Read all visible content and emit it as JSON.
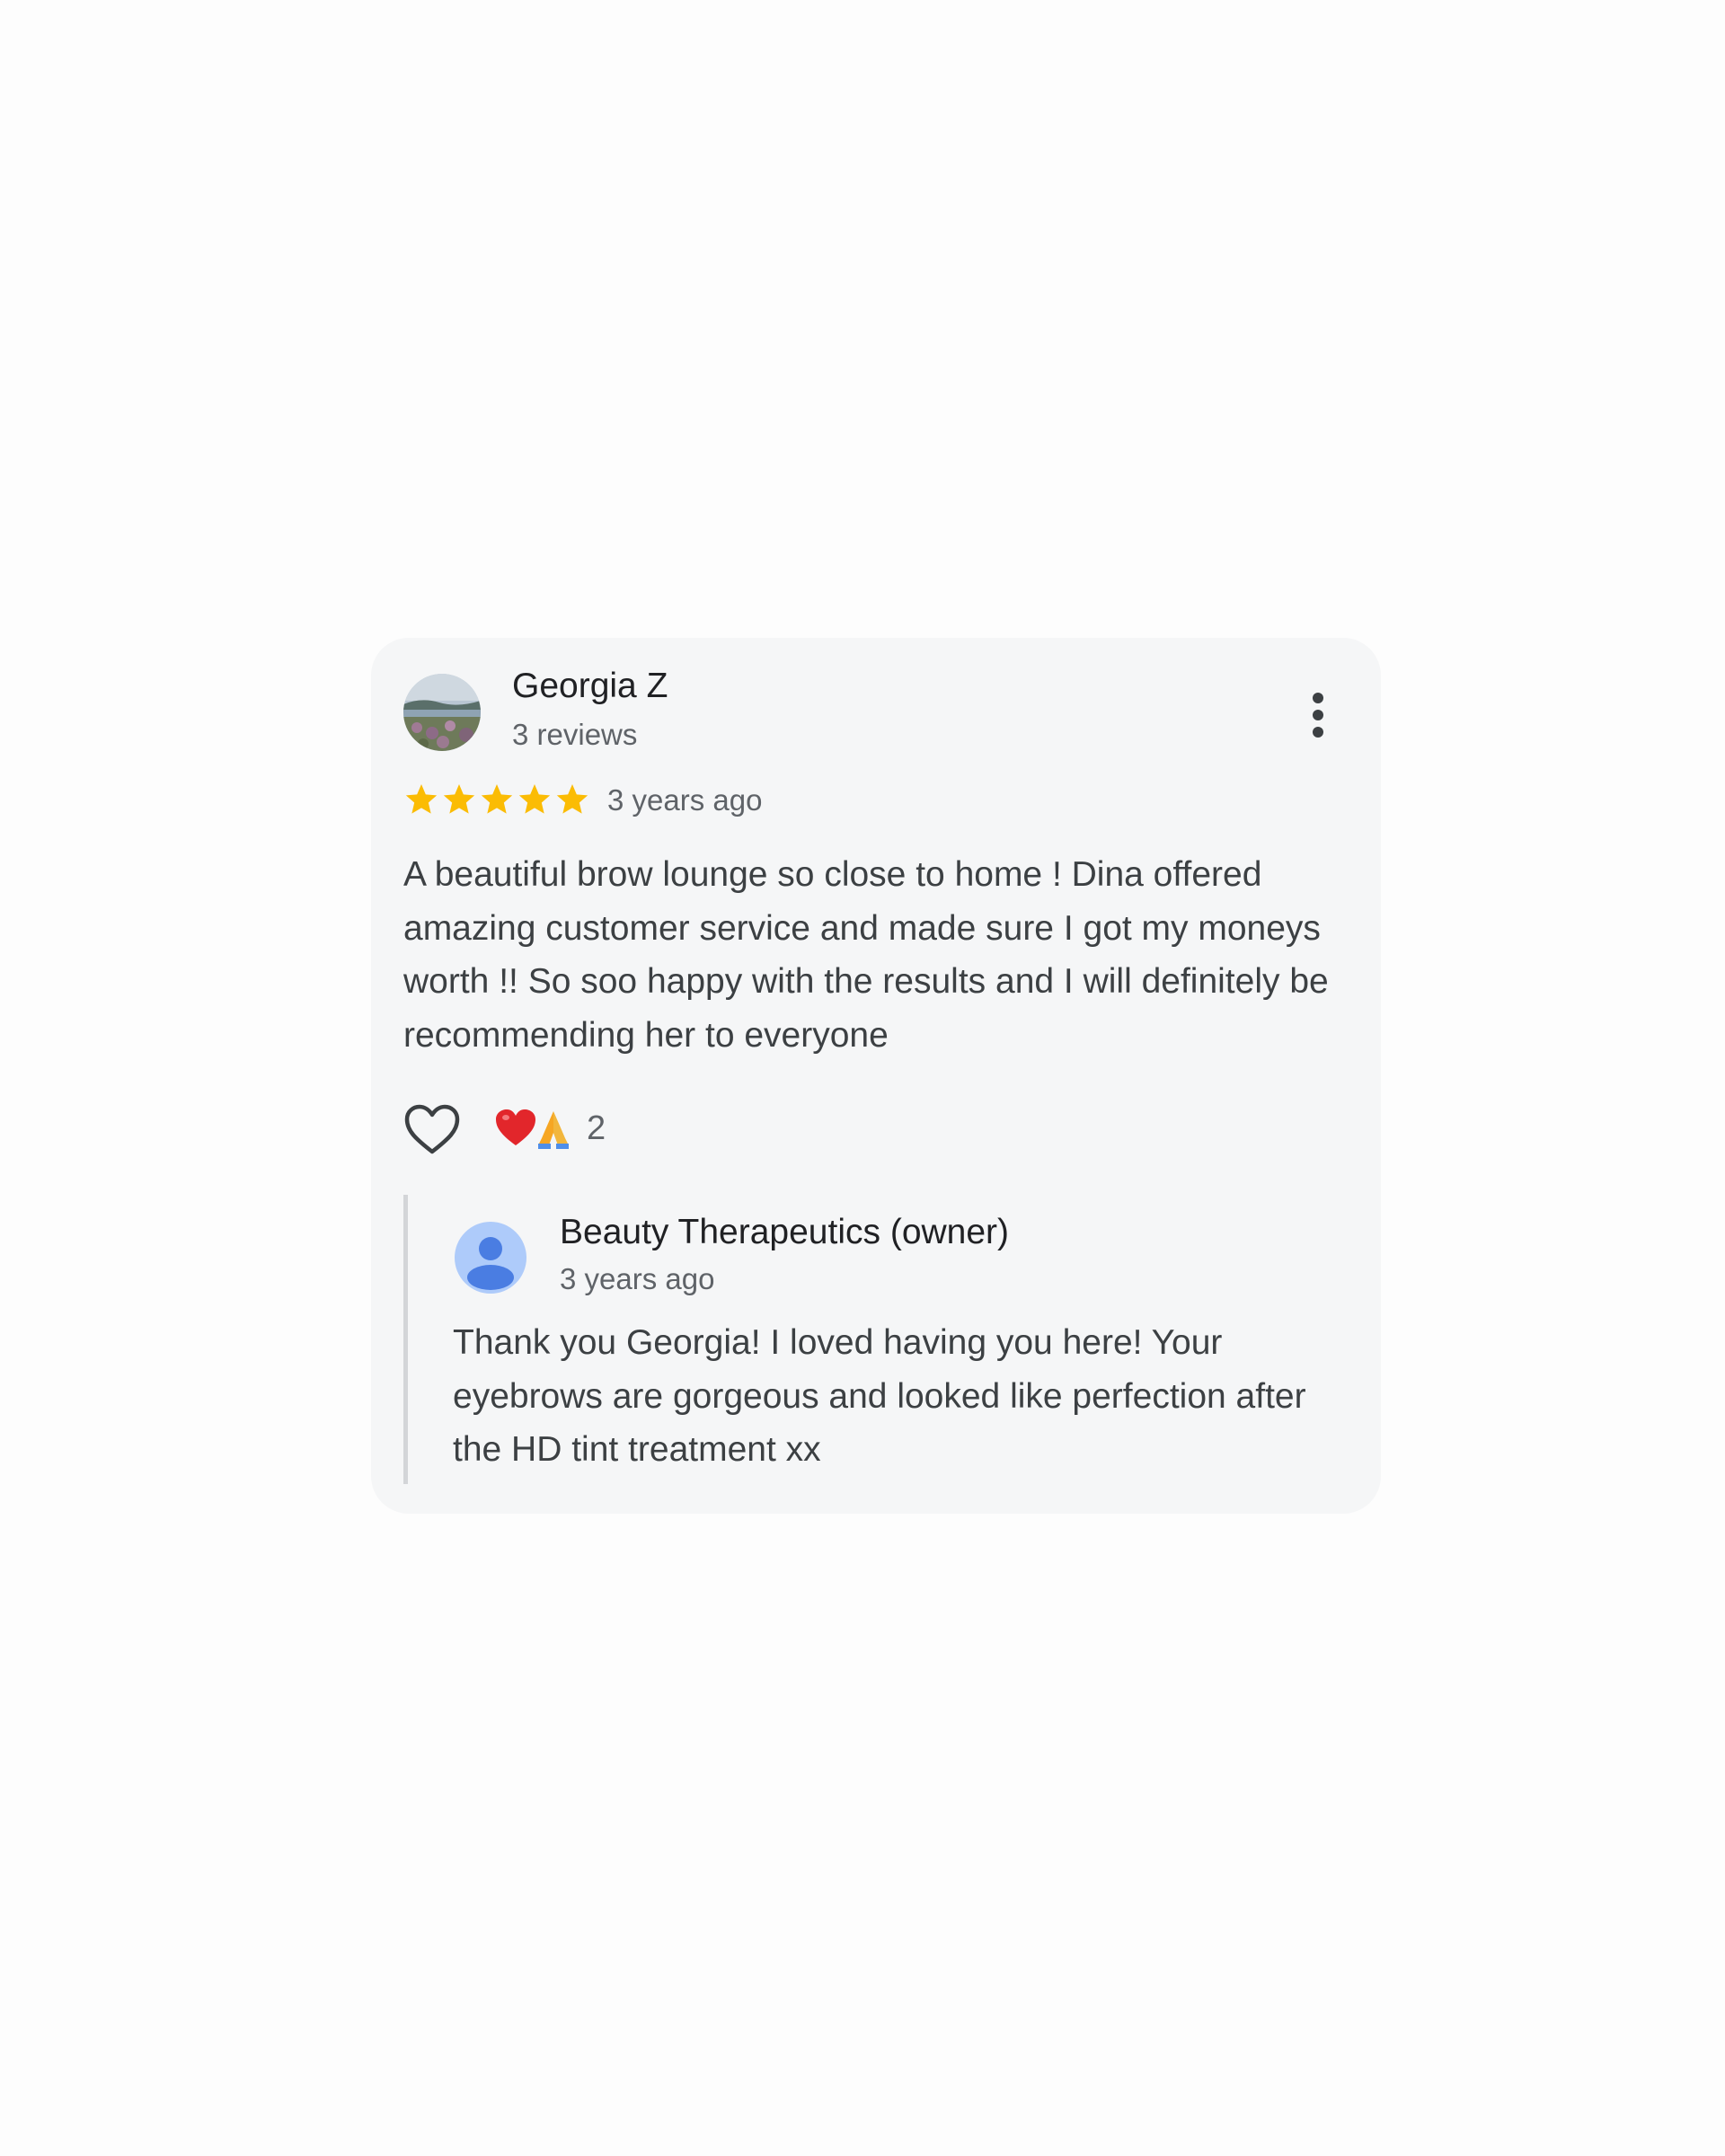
{
  "review": {
    "author_name": "Georgia Z",
    "author_reviews": "3 reviews",
    "rating": 5,
    "rating_max": 5,
    "date": "3 years ago",
    "text": "A beautiful brow lounge so close to home ! Dina offered amazing customer service and made sure I got my moneys worth !! So soo happy with the results and I will definitely be recommending her to everyone",
    "menu_icon": "more-vert-icon",
    "like_icon": "heart-outline-icon",
    "reactions": {
      "icons": [
        "red-heart-emoji",
        "folded-hands-emoji"
      ],
      "count": "2"
    }
  },
  "reply": {
    "owner_name": "Beauty Therapeutics (owner)",
    "date": "3 years ago",
    "text": "Thank you Georgia! I loved having you here! Your eyebrows are gorgeous and looked like perfection after the HD tint treatment xx",
    "avatar_icon": "default-person-icon"
  },
  "colors": {
    "star": "#fbbc04",
    "card_background": "#f5f6f7",
    "owner_avatar_bg": "#aecbfa",
    "owner_avatar_fg": "#4a7de2"
  }
}
